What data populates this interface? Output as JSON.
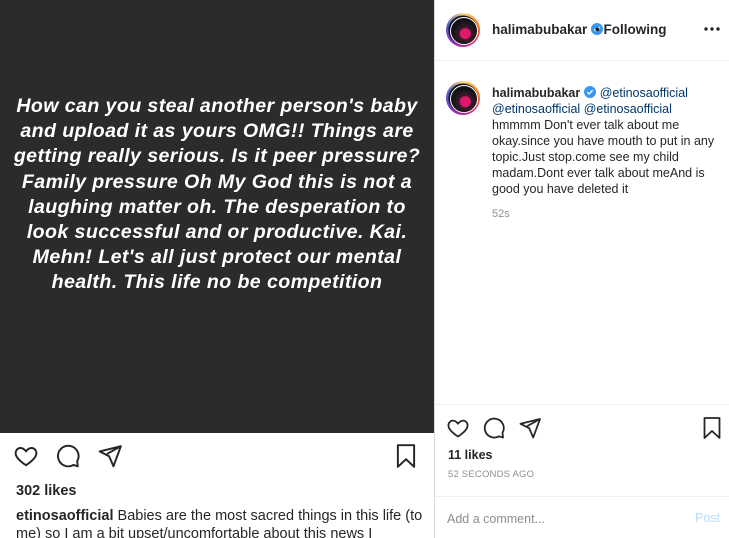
{
  "left_post": {
    "story_text": "How can you steal another person's baby and upload it as yours OMG!! Things are getting really serious. Is it peer pressure? Family pressure Oh My God this is not a laughing matter oh. The desperation to look successful and or productive. Kai. Mehn! Let's all just protect our mental health. This life no be competition",
    "likes": "302 likes",
    "caption_user": "etinosaofficial",
    "caption_text": " Babies are the most sacred things in this life (to me) so I am a bit upset/uncomfortable about this news I",
    "icons": [
      "heart-icon",
      "comment-icon",
      "share-icon",
      "bookmark-icon"
    ]
  },
  "right_panel": {
    "header": {
      "username": "halimabubakar",
      "follow_status": "• Following",
      "more_icon": "ellipsis-icon"
    },
    "comment": {
      "username": "halimabubakar",
      "mention_1": "@etinosaofficial",
      "mention_2": "@etinosaofficial",
      "mention_3": "@etinosaofficial",
      "text": "hmmmm Don't ever talk about me okay.since you have mouth to put in any topic.Just stop.come see my child madam.Dont ever talk about meAnd is good you have deleted it",
      "time": "52s"
    },
    "likes": "11 likes",
    "timestamp": "52 SECONDS AGO",
    "add_comment_placeholder": "Add a comment...",
    "post_label": "Post",
    "colors": {
      "mention": "#00376b",
      "verified": "#3897f0",
      "post_disabled": "#b2dffc",
      "story_bg": "#2b2b2b"
    }
  }
}
